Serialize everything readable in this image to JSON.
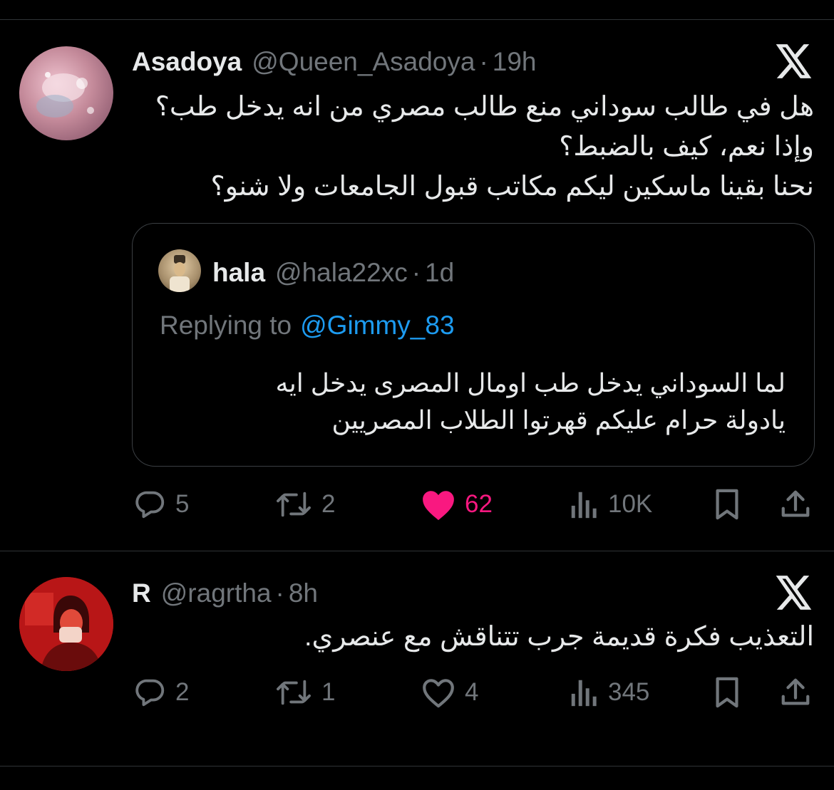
{
  "tweet1": {
    "name": "Asadoya",
    "handle": "@Queen_Asadoya",
    "sep": "·",
    "time": "19h",
    "body": "هل في طالب سوداني منع طالب مصري من انه يدخل طب؟ وإذا نعم، كيف بالضبط؟\nنحنا بقينا ماسكين ليكم مكاتب قبول الجامعات ولا شنو؟",
    "quote": {
      "name": "hala",
      "handle": "@hala22xc",
      "sep": "·",
      "time": "1d",
      "replying_label": "Replying to",
      "replying_to": "@Gimmy_83",
      "body": "لما السوداني يدخل طب اومال المصرى يدخل ايه\nيادولة حرام عليكم قهرتوا الطلاب المصريين"
    },
    "actions": {
      "replies": "5",
      "reposts": "2",
      "likes": "62",
      "views": "10K"
    }
  },
  "tweet2": {
    "name": "R",
    "handle": "@ragrtha",
    "sep": "·",
    "time": "8h",
    "body": "التعذيب فكرة قديمة جرب تتناقش مع عنصري.",
    "actions": {
      "replies": "2",
      "reposts": "1",
      "likes": "4",
      "views": "345"
    }
  },
  "icons": [
    "reply-icon",
    "repost-icon",
    "like-icon",
    "views-icon",
    "bookmark-icon",
    "share-icon",
    "x-logo-icon"
  ],
  "colors": {
    "background": "#000000",
    "text": "#e7e9ea",
    "muted": "#71767b",
    "link": "#1d9bf0",
    "like": "#f91880"
  }
}
